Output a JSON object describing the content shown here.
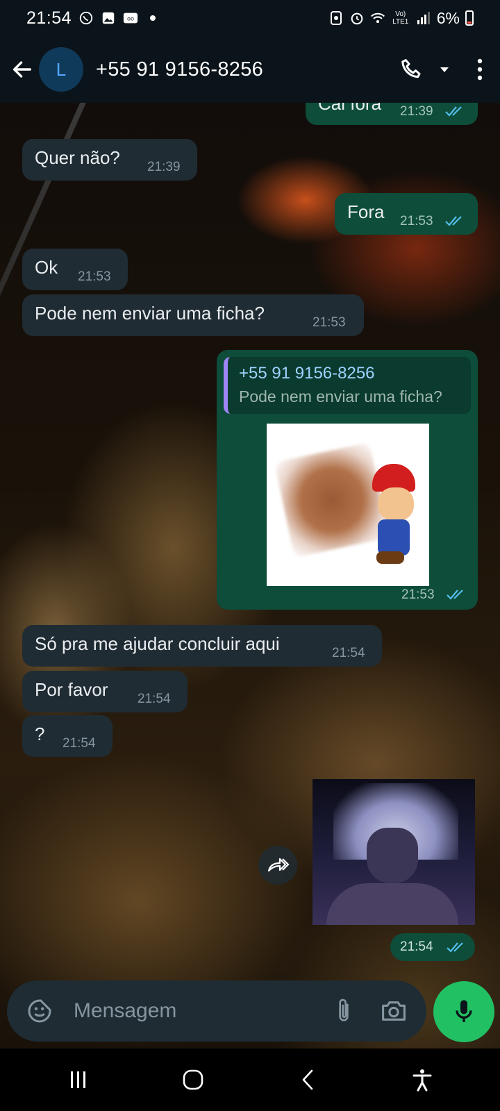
{
  "status_bar": {
    "time": "21:54",
    "network_label": "Vo) LTE1",
    "battery": "6%"
  },
  "header": {
    "avatar_letter": "L",
    "contact_name": "+55 91 9156-8256"
  },
  "messages": [
    {
      "direction": "out",
      "text": "Cai fora",
      "time": "21:39",
      "status": "read"
    },
    {
      "direction": "in",
      "text": "Quer não?",
      "time": "21:39"
    },
    {
      "direction": "out",
      "text": "Fora",
      "time": "21:53",
      "status": "read"
    },
    {
      "direction": "in",
      "text": "Ok",
      "time": "21:53"
    },
    {
      "direction": "in",
      "text": "Pode nem enviar uma ficha?",
      "time": "21:53"
    },
    {
      "direction": "out",
      "type": "sticker_reply",
      "quote_author": "+55 91 9156-8256",
      "quote_text": "Pode nem enviar uma ficha?",
      "time": "21:53",
      "status": "read"
    },
    {
      "direction": "in",
      "text": "Só pra me ajudar concluir aqui",
      "time": "21:54"
    },
    {
      "direction": "in",
      "text": "Por favor",
      "time": "21:54"
    },
    {
      "direction": "in",
      "text": "?",
      "time": "21:54"
    },
    {
      "direction": "out",
      "type": "sticker",
      "time": "21:54",
      "status": "read"
    }
  ],
  "input": {
    "placeholder": "Mensagem"
  },
  "colors": {
    "incoming_bubble": "#202c33",
    "outgoing_bubble": "#0d4d3a",
    "accent_green": "#21c063",
    "read_tick": "#53bdeb",
    "header_bg": "#0b141a"
  },
  "icons": [
    "whatsapp-icon",
    "gallery-icon",
    "cast-icon",
    "back-arrow-icon",
    "phone-icon",
    "dropdown-icon",
    "more-icon",
    "emoji-icon",
    "attach-icon",
    "camera-icon",
    "mic-icon",
    "forward-icon",
    "recents-icon",
    "home-icon",
    "nav-back-icon",
    "accessibility-icon"
  ]
}
